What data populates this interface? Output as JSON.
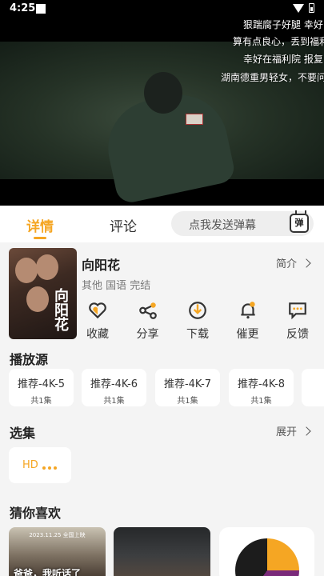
{
  "status_bar": {
    "time": "4:25"
  },
  "video": {
    "danmaku": [
      "狠踹腐子好腿 幸好",
      "算有点良心，丢到福利",
      "幸好在福利院 报复",
      "湖南德重男轻女，不要问"
    ]
  },
  "tabs": {
    "detail": "详情",
    "comment": "评论"
  },
  "danmaku_input": {
    "placeholder": "点我发送弹幕",
    "button": "弹"
  },
  "show": {
    "poster_title": "向阳花",
    "title": "向阳花",
    "meta": "其他 国语 完结",
    "intro_link": "简介"
  },
  "actions": [
    {
      "label": "收藏",
      "icon": "heart-icon"
    },
    {
      "label": "分享",
      "icon": "share-icon"
    },
    {
      "label": "下载",
      "icon": "download-icon"
    },
    {
      "label": "催更",
      "icon": "bell-icon"
    },
    {
      "label": "反馈",
      "icon": "feedback-icon"
    }
  ],
  "sources": {
    "title": "播放源",
    "items": [
      {
        "name": "推荐-4K-5",
        "count": "共1集"
      },
      {
        "name": "推荐-4K-6",
        "count": "共1集"
      },
      {
        "name": "推荐-4K-7",
        "count": "共1集"
      },
      {
        "name": "推荐-4K-8",
        "count": "共1集"
      },
      {
        "name": "推",
        "count": "共"
      }
    ]
  },
  "episodes": {
    "title": "选集",
    "expand": "展开",
    "current": "HD"
  },
  "recommend": {
    "title": "猜你喜欢",
    "items": [
      {
        "overlay": "爸爸，我听话了",
        "top": "2023.11.25 全国上映"
      },
      {
        "overlay": "",
        "top": ""
      },
      {
        "overlay": "",
        "top": ""
      }
    ]
  },
  "colors": {
    "accent": "#f5a623",
    "background": "#f4f4f4"
  }
}
